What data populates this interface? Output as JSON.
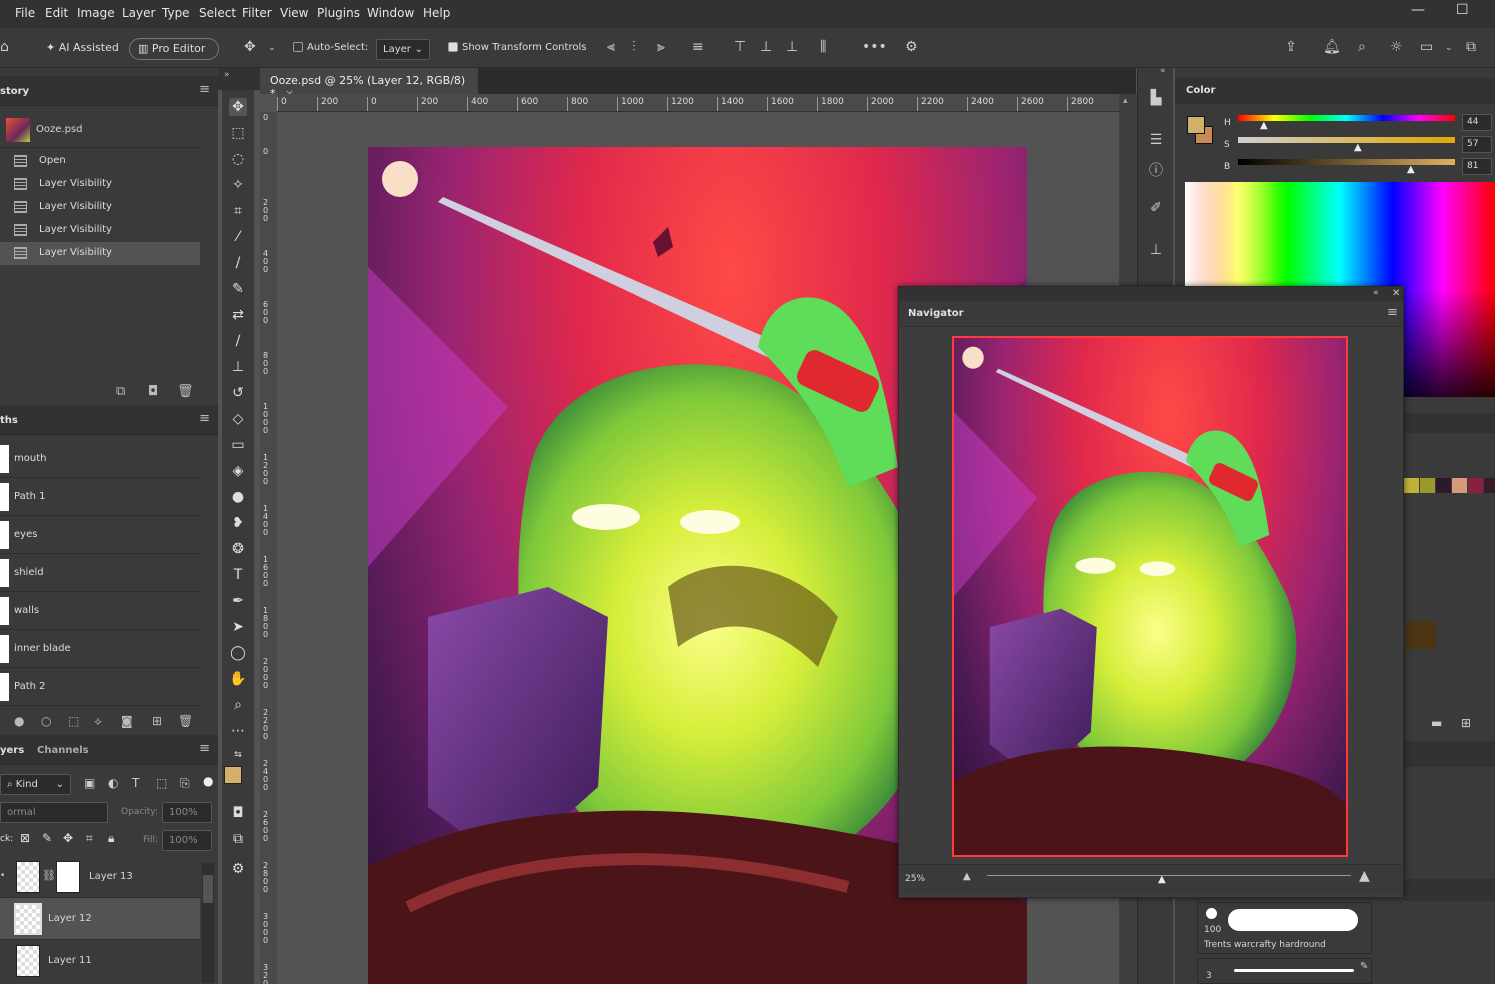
{
  "menu": [
    "File",
    "Edit",
    "Image",
    "Layer",
    "Type",
    "Select",
    "Filter",
    "View",
    "Plugins",
    "Window",
    "Help"
  ],
  "window_controls": {
    "minimize": "—",
    "maximize": "☐"
  },
  "options": {
    "ai_assisted": "AI Assisted",
    "pro_editor": "Pro Editor",
    "auto_select": "Auto-Select:",
    "auto_select_value": "Layer",
    "show_transform": "Show Transform Controls"
  },
  "history": {
    "title": "story",
    "doc": "Ooze.psd",
    "items": [
      "Open",
      "Layer Visibility",
      "Layer Visibility",
      "Layer Visibility",
      "Layer Visibility"
    ]
  },
  "paths": {
    "title": "ths",
    "items": [
      "mouth",
      "Path 1",
      "eyes",
      "shield",
      "walls",
      "inner blade",
      "Path 2"
    ]
  },
  "layers": {
    "tabs": [
      "yers",
      "Channels"
    ],
    "filter": "Kind",
    "blend": "ormal",
    "opacity_label": "Opacity:",
    "opacity": "100%",
    "lock_label": "ck:",
    "fill_label": "Fill:",
    "fill": "100%",
    "items": [
      "Layer 13",
      "Layer 12",
      "Layer 11"
    ]
  },
  "document": {
    "tab_title": "Ooze.psd @ 25% (Layer 12, RGB/8) *",
    "close": "×"
  },
  "hruler_ticks": [
    "0",
    "200",
    "0",
    "200",
    "400",
    "600",
    "800",
    "1000",
    "1200",
    "1400",
    "1600",
    "1800",
    "2000",
    "2200",
    "2400",
    "2600",
    "2800"
  ],
  "vruler_ticks": [
    "0",
    "0",
    "200",
    "400",
    "600",
    "800",
    "1000",
    "1200",
    "1400",
    "1600",
    "1800",
    "2000",
    "2200",
    "2400",
    "2600",
    "2800",
    "3000",
    "3200"
  ],
  "color": {
    "title": "Color",
    "h_label": "H",
    "h": "44",
    "s_label": "S",
    "s": "57",
    "b_label": "B",
    "b": "81",
    "fg": "#d1b06b",
    "bg": "#c68a55"
  },
  "navigator": {
    "title": "Navigator",
    "zoom": "25%"
  },
  "brush": {
    "size": "100",
    "name": "Trents warcrafty hardround",
    "size2": "3"
  },
  "swatches": [
    "#c2b23a",
    "#9a9a2a",
    "#2a1a2a",
    "#d49a7a",
    "#8a2040",
    "#3a1a2a"
  ]
}
